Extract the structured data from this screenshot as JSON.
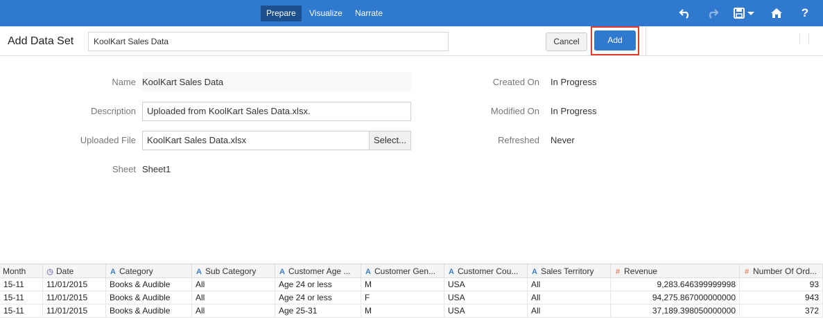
{
  "topbar": {
    "tabs": [
      {
        "label": "Prepare",
        "active": true
      },
      {
        "label": "Visualize",
        "active": false
      },
      {
        "label": "Narrate",
        "active": false
      }
    ],
    "icons": [
      "undo-icon",
      "redo-icon",
      "save-icon",
      "home-icon",
      "help-icon"
    ],
    "help_glyph": "?"
  },
  "header": {
    "title": "Add Data Set",
    "dataset_name": "KoolKart Sales Data",
    "cancel_label": "Cancel",
    "add_label": "Add"
  },
  "form": {
    "name_label": "Name",
    "name_value": "KoolKart Sales Data",
    "description_label": "Description",
    "description_value": "Uploaded from KoolKart Sales Data.xlsx.",
    "uploaded_file_label": "Uploaded File",
    "uploaded_file_value": "KoolKart Sales Data.xlsx",
    "select_label": "Select...",
    "sheet_label": "Sheet",
    "sheet_value": "Sheet1",
    "created_on_label": "Created On",
    "created_on_value": "In Progress",
    "modified_on_label": "Modified On",
    "modified_on_value": "In Progress",
    "refreshed_label": "Refreshed",
    "refreshed_value": "Never"
  },
  "grid": {
    "columns": [
      {
        "label": "Month",
        "type": "none"
      },
      {
        "label": "Date",
        "type": "date"
      },
      {
        "label": "Category",
        "type": "text"
      },
      {
        "label": "Sub Category",
        "type": "text"
      },
      {
        "label": "Customer Age ...",
        "type": "text"
      },
      {
        "label": "Customer Gen...",
        "type": "text"
      },
      {
        "label": "Customer Cou...",
        "type": "text"
      },
      {
        "label": "Sales Territory",
        "type": "text"
      },
      {
        "label": "Revenue",
        "type": "number"
      },
      {
        "label": "Number Of Ord...",
        "type": "number"
      }
    ],
    "type_glyphs": {
      "text": "A",
      "number": "#",
      "date": "◷"
    },
    "rows": [
      [
        "15-11",
        "11/01/2015",
        "Books & Audible",
        "All",
        "Age 24 or less",
        "M",
        "USA",
        "All",
        "9,283.646399999998",
        "93"
      ],
      [
        "15-11",
        "11/01/2015",
        "Books & Audible",
        "All",
        "Age 24 or less",
        "F",
        "USA",
        "All",
        "94,275.867000000000",
        "943"
      ],
      [
        "15-11",
        "11/01/2015",
        "Books & Audible",
        "All",
        "Age 25-31",
        "M",
        "USA",
        "All",
        "37,189.398050000000",
        "372"
      ]
    ]
  },
  "colors": {
    "topbar": "#2f79cf",
    "active_tab": "#1b4f8e",
    "highlight": "#e03a2c",
    "text_type_icon": "#3a7ec4",
    "number_type_icon": "#e8836c",
    "date_type_icon": "#8e7cc3"
  }
}
